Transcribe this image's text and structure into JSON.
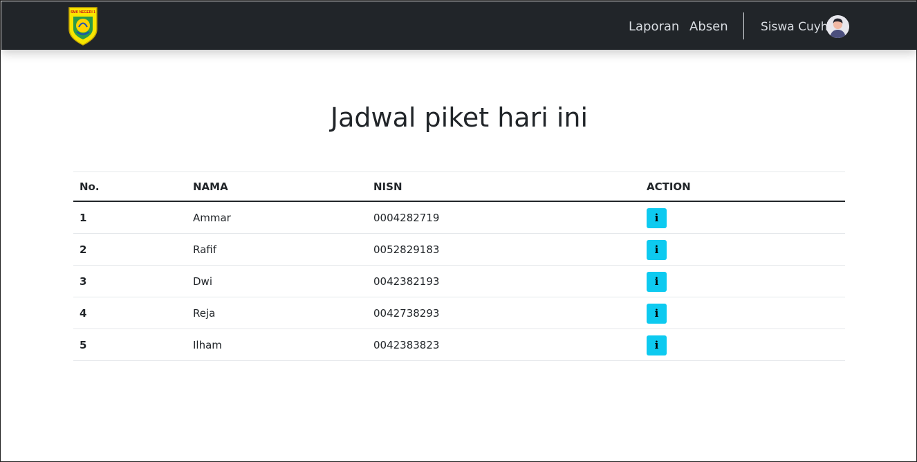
{
  "navbar": {
    "brand_logo": "school-crest-logo",
    "brand_logo_text": "SMK NEGERI 1",
    "links": [
      {
        "label": "Laporan"
      },
      {
        "label": "Absen"
      }
    ],
    "user": {
      "name": "Siswa Cuyh",
      "avatar_icon": "user-avatar-icon"
    },
    "colors": {
      "background": "#212529",
      "link": "#d9dde2"
    }
  },
  "main": {
    "title": "Jadwal piket hari ini",
    "table": {
      "headers": [
        "No.",
        "NAMA",
        "NISN",
        "ACTION"
      ],
      "rows": [
        {
          "no": "1",
          "nama": "Ammar",
          "nisn": "0004282719",
          "action_icon": "info-icon",
          "action_label": "i"
        },
        {
          "no": "2",
          "nama": "Rafif",
          "nisn": "0052829183",
          "action_icon": "info-icon",
          "action_label": "i"
        },
        {
          "no": "3",
          "nama": "Dwi",
          "nisn": "0042382193",
          "action_icon": "info-icon",
          "action_label": "i"
        },
        {
          "no": "4",
          "nama": "Reja",
          "nisn": "0042738293",
          "action_icon": "info-icon",
          "action_label": "i"
        },
        {
          "no": "5",
          "nama": "Ilham",
          "nisn": "0042383823",
          "action_icon": "info-icon",
          "action_label": "i"
        }
      ]
    },
    "colors": {
      "action_button": "#0dcaf0"
    }
  }
}
